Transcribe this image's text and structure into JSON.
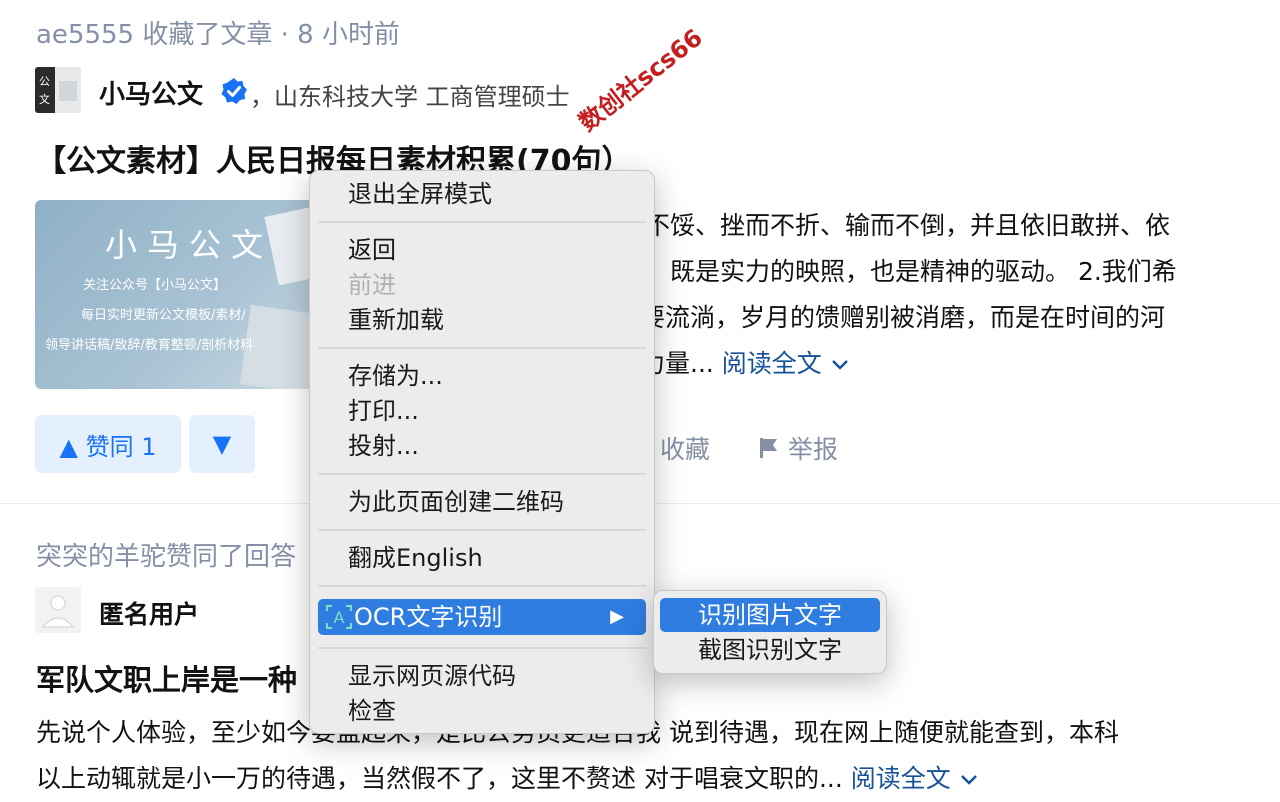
{
  "feed": {
    "item1": {
      "activity": "ae5555 收藏了文章 · 8 小时前",
      "author_name": "小马公文",
      "author_desc": "，山东科技大学 工商管理硕士",
      "title": "【公文素材】人民日报每日素材积累(70句）",
      "thumbnail": {
        "heading": "小马公文",
        "line1": "关注公众号【小马公文】",
        "line2": "每日实时更新公文模板/素材/",
        "line3": "领导讲话稿/致辞/教育整顿/剖析材料"
      },
      "excerpt_lines": [
        "而不馁、挫而不折、输而不倒，并且依旧敢拼、依",
        "既是实力的映照，也是精神的驱动。 2.我们希",
        "要流淌，岁月的馈赠别被消磨，而是在时间的河",
        "力量..."
      ],
      "read_more": "阅读全文",
      "upvote_label": "▲ 赞同 1",
      "downvote_label": "▼",
      "collect_label": "收藏",
      "report_label": "举报"
    },
    "item2": {
      "activity": "突突的羊驼赞同了回答",
      "author_name": "匿名用户",
      "title": "军队文职上岸是一种",
      "excerpt_line1": "先说个人体验，至少如今要盖起来，是比公务员更适合我 说到待遇，现在网上随便就能查到，本科",
      "excerpt_line2": "以上动辄就是小一万的待遇，当然假不了，这里不赘述 对于唱衰文职的...",
      "read_more": "阅读全文"
    }
  },
  "watermark": "数创社scs66",
  "context_menu": {
    "items": [
      {
        "label": "退出全屏模式",
        "disabled": false
      },
      {
        "label": "返回",
        "disabled": false
      },
      {
        "label": "前进",
        "disabled": true
      },
      {
        "label": "重新加载",
        "disabled": false
      },
      {
        "label": "存储为...",
        "disabled": false
      },
      {
        "label": "打印...",
        "disabled": false
      },
      {
        "label": "投射...",
        "disabled": false
      },
      {
        "label": "为此页面创建二维码",
        "disabled": false
      },
      {
        "label": "翻成English",
        "disabled": false
      },
      {
        "label": "OCR文字识别",
        "disabled": false,
        "highlighted": true,
        "has_submenu": true
      },
      {
        "label": "显示网页源代码",
        "disabled": false
      },
      {
        "label": "检查",
        "disabled": false
      }
    ],
    "submenu": [
      {
        "label": "识别图片文字",
        "highlighted": true
      },
      {
        "label": "截图识别文字",
        "highlighted": false
      }
    ],
    "submenu_arrow": "▶"
  },
  "colors": {
    "accent_blue": "#1772f6",
    "menu_highlight": "#2f7de1",
    "meta_gray": "#8590a6",
    "link": "#175199",
    "watermark_red": "#c41e1e"
  }
}
